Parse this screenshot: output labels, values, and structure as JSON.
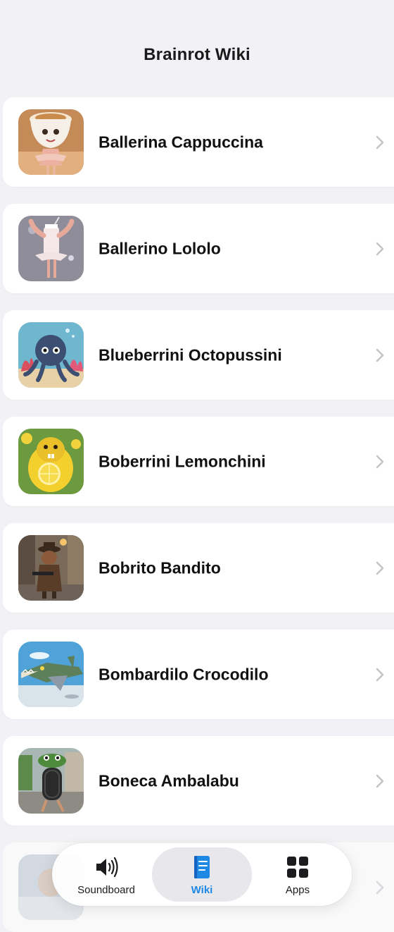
{
  "header": {
    "title": "Brainrot Wiki"
  },
  "list": {
    "items": [
      {
        "label": "Ballerina Cappuccina",
        "thumb_icon": "ballerina-cappuccina-thumbnail"
      },
      {
        "label": "Ballerino Lololo",
        "thumb_icon": "ballerino-lololo-thumbnail"
      },
      {
        "label": "Blueberrini Octopussini",
        "thumb_icon": "blueberrini-octopussini-thumbnail"
      },
      {
        "label": "Boberrini Lemonchini",
        "thumb_icon": "boberrini-lemonchini-thumbnail"
      },
      {
        "label": "Bobrito Bandito",
        "thumb_icon": "bobrito-bandito-thumbnail"
      },
      {
        "label": "Bombardilo Crocodilo",
        "thumb_icon": "bombardilo-crocodilo-thumbnail"
      },
      {
        "label": "Boneca Ambalabu",
        "thumb_icon": "boneca-ambalabu-thumbnail"
      }
    ],
    "chevron_icon": "chevron-right-icon"
  },
  "tab_bar": {
    "tabs": [
      {
        "label": "Soundboard",
        "icon": "speaker-wave-icon",
        "active": false
      },
      {
        "label": "Wiki",
        "icon": "book-icon",
        "active": true
      },
      {
        "label": "Apps",
        "icon": "grid-icon",
        "active": false
      }
    ]
  },
  "colors": {
    "background": "#f2f2f6",
    "card": "#ffffff",
    "accent": "#1e88e5",
    "chevron": "#c4c4c7"
  }
}
